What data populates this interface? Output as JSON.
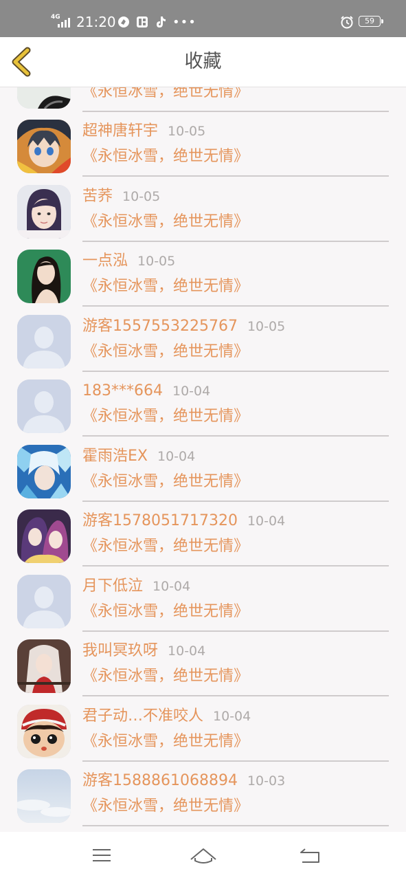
{
  "status_bar": {
    "network": "4G",
    "time": "21:20",
    "battery": "59"
  },
  "header": {
    "title": "收藏"
  },
  "items": [
    {
      "name": "",
      "date": "",
      "book": "《永恒冰雪，绝世无情》",
      "avatar": "anime-avatar"
    },
    {
      "name": "超神唐轩宇",
      "date": "10-05",
      "book": "《永恒冰雪，绝世无情》",
      "avatar": "anime-avatar"
    },
    {
      "name": "苦荞",
      "date": "10-05",
      "book": "《永恒冰雪，绝世无情》",
      "avatar": "photo-avatar"
    },
    {
      "name": "一点泓",
      "date": "10-05",
      "book": "《永恒冰雪，绝世无情》",
      "avatar": "photo-avatar"
    },
    {
      "name": "游客1557553225767",
      "date": "10-05",
      "book": "《永恒冰雪，绝世无情》",
      "avatar": "default-avatar"
    },
    {
      "name": "183***664",
      "date": "10-04",
      "book": "《永恒冰雪，绝世无情》",
      "avatar": "default-avatar"
    },
    {
      "name": "霍雨浩EX",
      "date": "10-04",
      "book": "《永恒冰雪，绝世无情》",
      "avatar": "anime-avatar"
    },
    {
      "name": "游客1578051717320",
      "date": "10-04",
      "book": "《永恒冰雪，绝世无情》",
      "avatar": "anime-avatar"
    },
    {
      "name": "月下低泣",
      "date": "10-04",
      "book": "《永恒冰雪，绝世无情》",
      "avatar": "default-avatar"
    },
    {
      "name": "我叫冥玖呀",
      "date": "10-04",
      "book": "《永恒冰雪，绝世无情》",
      "avatar": "anime-avatar"
    },
    {
      "name": "君子动…不准咬人",
      "date": "10-04",
      "book": "《永恒冰雪，绝世无情》",
      "avatar": "doll-avatar"
    },
    {
      "name": "游客1588861068894",
      "date": "10-03",
      "book": "《永恒冰雪，绝世无情》",
      "avatar": "sky-avatar"
    }
  ],
  "nav": {
    "menu_icon": "menu-icon",
    "home_icon": "home-icon",
    "back_icon": "return-icon"
  },
  "colors": {
    "accent": "#e5955c",
    "date": "#aeaaa9",
    "back_arrow": "#e8c23a",
    "status_bar": "#8a8a8a"
  }
}
